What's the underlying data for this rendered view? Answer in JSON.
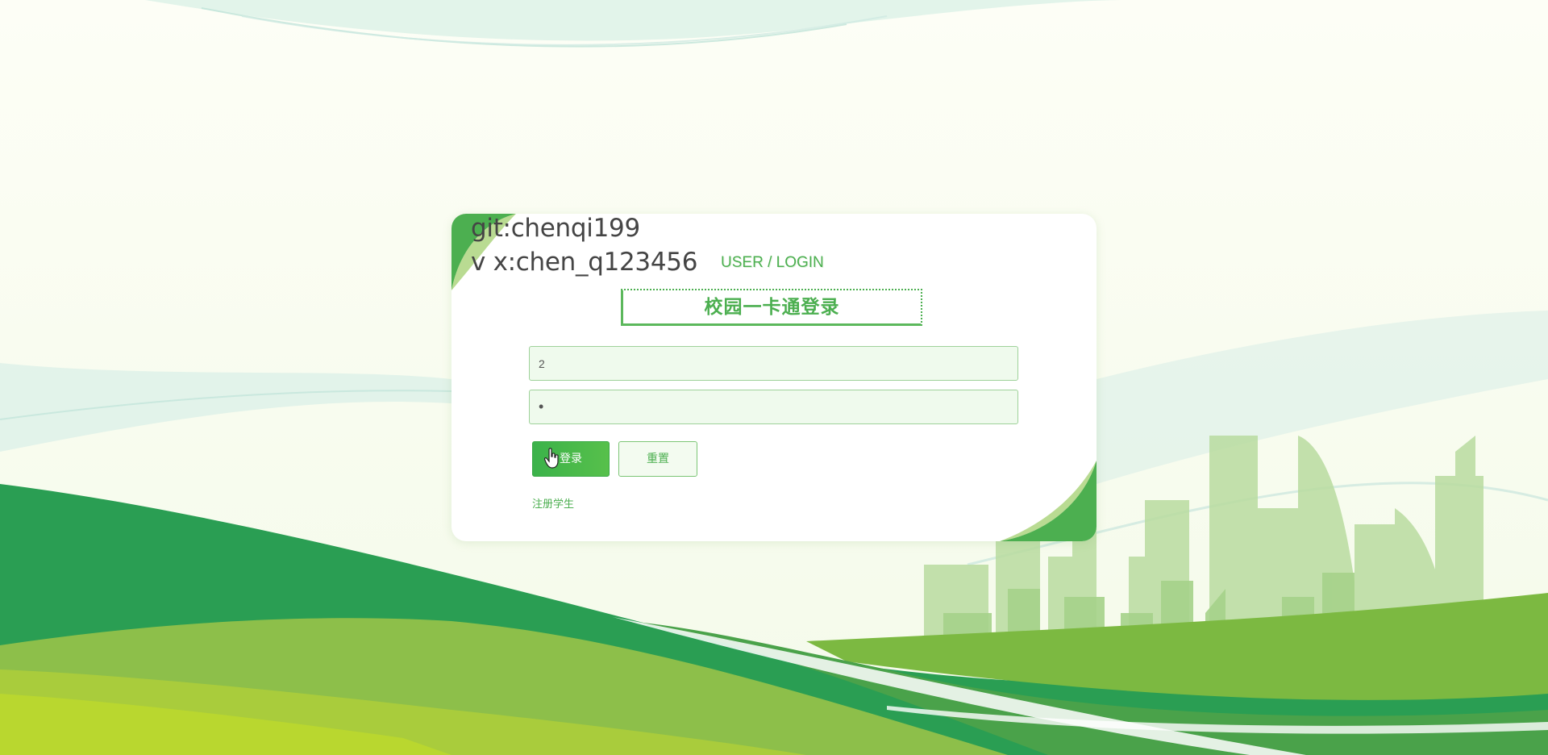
{
  "info": {
    "git": "git:chenqi199",
    "wechat": "v x:chen_q123456"
  },
  "login": {
    "subtitle": "USER / LOGIN",
    "title": "校园一卡通登录",
    "username_value": "2",
    "password_value": "•",
    "login_button": "登录",
    "reset_button": "重置",
    "register_link": "注册学生"
  },
  "colors": {
    "accent": "#4caf50",
    "dark_green": "#2a9e53",
    "light_green": "#8cc63f"
  },
  "icons": {
    "cursor": "hand-pointer-icon"
  }
}
